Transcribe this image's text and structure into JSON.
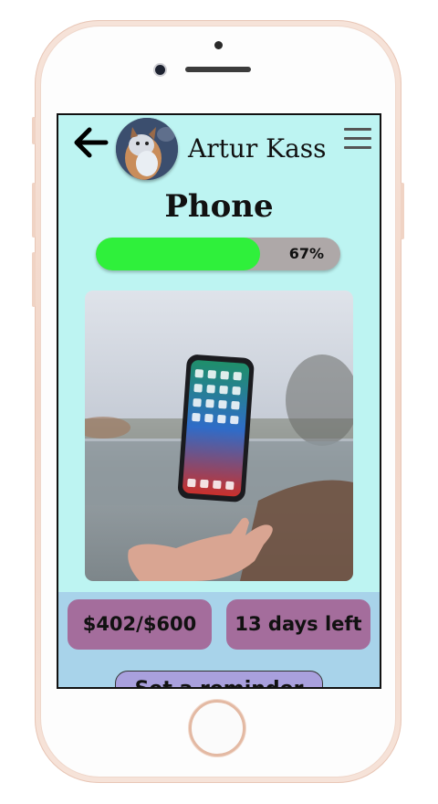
{
  "header": {
    "user_name": "Artur Kass",
    "back_icon": "arrow-left-icon",
    "menu_icon": "hamburger-menu-icon"
  },
  "goal": {
    "title": "Phone",
    "progress_label": "67%",
    "progress_fraction": 0.67,
    "image_alt": "Phone floating above a hand"
  },
  "stats": {
    "saved_amount": "$402/$600",
    "time_left": "13 days left"
  },
  "actions": {
    "set_reminder_label": "Set a reminder"
  },
  "colors": {
    "screen_bg": "#bdf4f2",
    "progress_fill": "#2ff03b",
    "progress_track": "#aea8a8",
    "stat_pill": "#a46d9c",
    "stats_band": "#a8d3ea",
    "reminder_button": "#a9a0dd"
  }
}
